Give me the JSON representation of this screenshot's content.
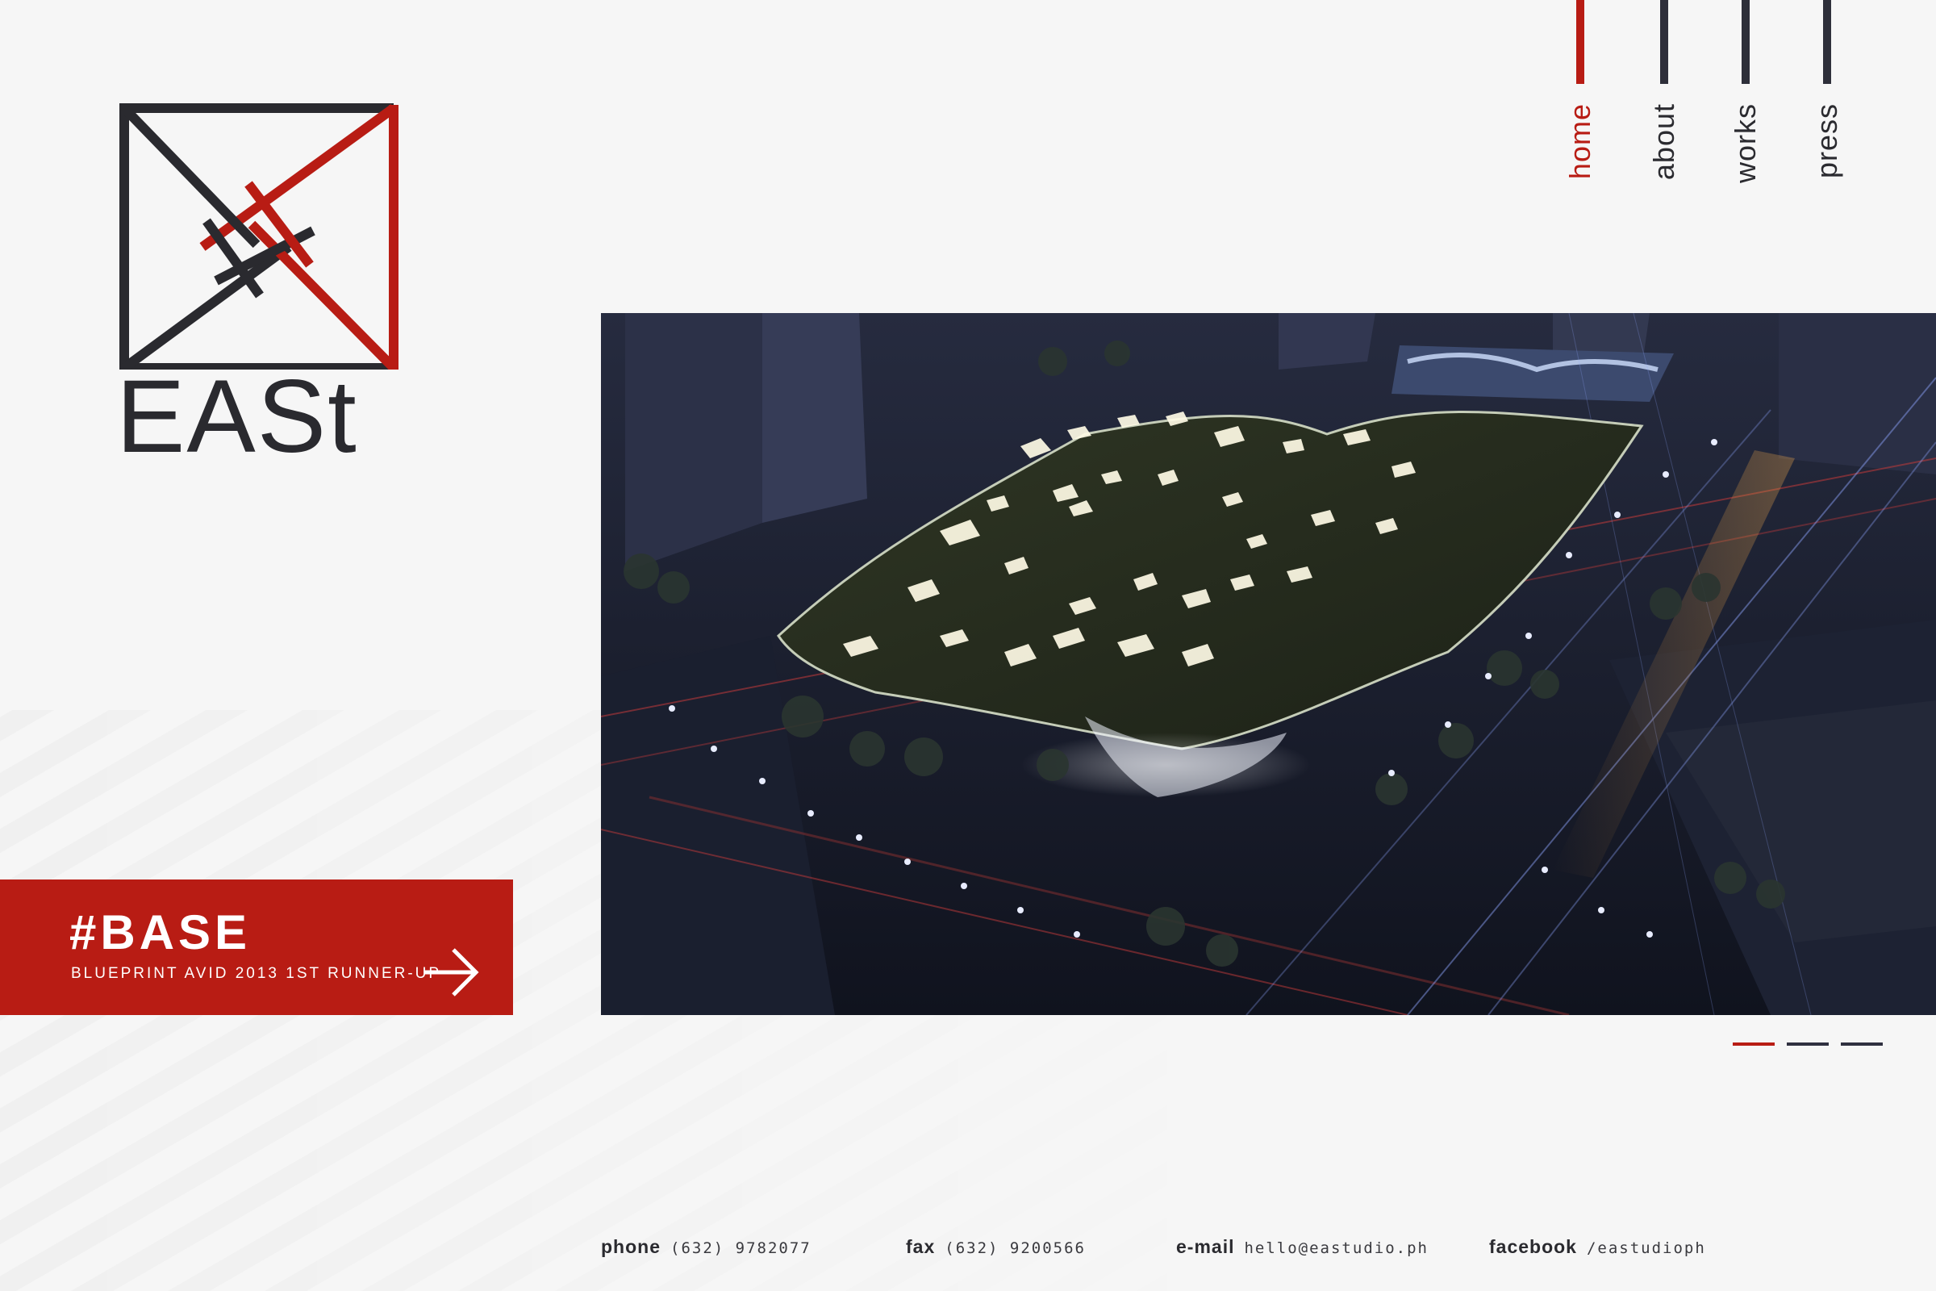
{
  "brand": {
    "wordmark": "EASt",
    "colors": {
      "accent": "#b81c14",
      "dark": "#2a2a2f",
      "background": "#f6f6f6"
    }
  },
  "nav": {
    "items": [
      {
        "label": "home",
        "active": true
      },
      {
        "label": "about",
        "active": false
      },
      {
        "label": "works",
        "active": false
      },
      {
        "label": "press",
        "active": false
      }
    ]
  },
  "feature": {
    "title": "#BASE",
    "subtitle": "BLUEPRINT AVID 2013 1ST RUNNER-UP",
    "arrow_icon": "arrow-right-icon"
  },
  "hero": {
    "image_icon": "architectural-rendering"
  },
  "slider": {
    "slide_count": 3,
    "active_index": 0
  },
  "contact": {
    "phone": {
      "label": "phone",
      "value": "(632) 9782077"
    },
    "fax": {
      "label": "fax",
      "value": "(632) 9200566"
    },
    "email": {
      "label": "e-mail",
      "value": "hello@eastudio.ph"
    },
    "facebook": {
      "label": "facebook",
      "value": "/eastudioph"
    }
  }
}
